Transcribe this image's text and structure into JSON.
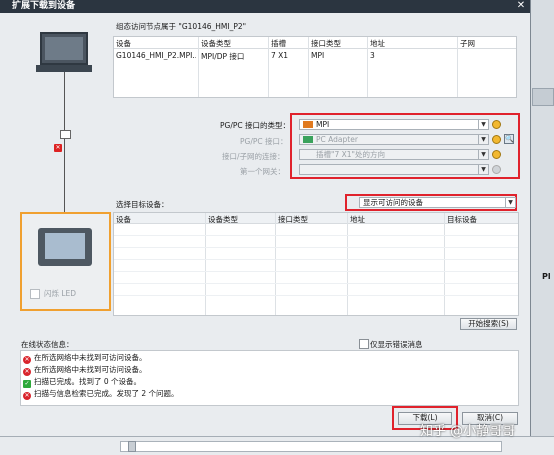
{
  "dialog": {
    "title": "扩展下载到设备"
  },
  "configured": {
    "caption": "组态访问节点属于 \"G10146_HMI_P2\"",
    "columns": [
      "设备",
      "设备类型",
      "插槽",
      "接口类型",
      "地址",
      "子网"
    ],
    "rows": [
      [
        "G10146_HMI_P2.MPI...",
        "MPI/DP 接口",
        "7 X1",
        "MPI",
        "3",
        ""
      ]
    ]
  },
  "interface": {
    "pgpc_type_label": "PG/PC 接口的类型：",
    "pgpc_type_value": "MPI",
    "pgpc_iface_label": "PG/PC 接口：",
    "pgpc_iface_value": "PC Adapter",
    "subnet_conn_label": "接口/子网的连接：",
    "subnet_conn_value": "插槽\"7 X1\"处的方向",
    "gateway_label": "第一个网关：",
    "gateway_value": ""
  },
  "target": {
    "label": "选择目标设备：",
    "filter_value": "显示可访问的设备",
    "columns": [
      "设备",
      "设备类型",
      "接口类型",
      "地址",
      "目标设备"
    ]
  },
  "device_panel": {
    "flash_led_label": "闪烁 LED"
  },
  "buttons": {
    "start_search": "开始搜索(S)",
    "load": "下载(L)",
    "cancel": "取消(C)"
  },
  "status": {
    "label": "在线状态信息：",
    "errors_only_label": "仅显示错误消息",
    "messages": [
      {
        "type": "error",
        "text": "在所选网络中未找到可访问设备。"
      },
      {
        "type": "error",
        "text": "在所选网络中未找到可访问设备。"
      },
      {
        "type": "ok",
        "text": "扫描已完成。找到了 0 个设备。"
      },
      {
        "type": "error",
        "text": "扫描与信息检索已完成。发现了 2 个问题。"
      }
    ]
  },
  "background": {
    "right_panel_label": "Pl"
  },
  "watermark": "知乎 @小静哥哥"
}
